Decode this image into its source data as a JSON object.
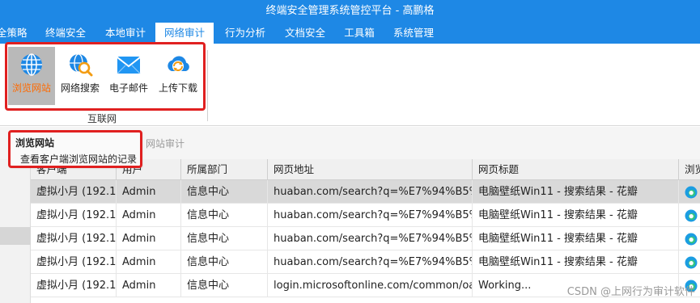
{
  "window": {
    "title": "终端安全管理系统管控平台 - 高鹏格"
  },
  "menu": {
    "items": [
      {
        "label": "全策略"
      },
      {
        "label": "终端安全"
      },
      {
        "label": "本地审计"
      },
      {
        "label": "网络审计",
        "active": true
      },
      {
        "label": "行为分析"
      },
      {
        "label": "文档安全"
      },
      {
        "label": "工具箱"
      },
      {
        "label": "系统管理"
      }
    ]
  },
  "ribbon": {
    "buttons": [
      {
        "label": "浏览网站",
        "icon": "globe-icon",
        "selected": true
      },
      {
        "label": "网络搜索",
        "icon": "globe-search-icon"
      },
      {
        "label": "电子邮件",
        "icon": "envelope-icon"
      },
      {
        "label": "上传下载",
        "icon": "cloud-sync-icon"
      }
    ],
    "group_label": "互联网"
  },
  "subbar": {
    "text": "网站审计"
  },
  "tooltip": {
    "title": "浏览网站",
    "description": "查看客户端浏览网站的记录"
  },
  "table": {
    "columns": [
      "客户端",
      "用户",
      "所属部门",
      "网页地址",
      "网页标题",
      "浏览"
    ],
    "rows": [
      {
        "client": "虚拟小月 (192.1...",
        "user": "Admin",
        "dept": "信息中心",
        "url": "huaban.com/search?q=%E7%94%B5%E...",
        "title": "电脑壁纸Win11 - 搜索结果 - 花瓣",
        "browser": "edge-icon",
        "selected": true
      },
      {
        "client": "虚拟小月 (192.1...",
        "user": "Admin",
        "dept": "信息中心",
        "url": "huaban.com/search?q=%E7%94%B5%E...",
        "title": "电脑壁纸Win11 - 搜索结果 - 花瓣",
        "browser": "edge-icon"
      },
      {
        "client": "虚拟小月 (192.1...",
        "user": "Admin",
        "dept": "信息中心",
        "url": "huaban.com/search?q=%E7%94%B5%E...",
        "title": "电脑壁纸Win11 - 搜索结果 - 花瓣",
        "browser": "edge-icon"
      },
      {
        "client": "虚拟小月 (192.1...",
        "user": "Admin",
        "dept": "信息中心",
        "url": "huaban.com/search?q=%E7%94%B5%E...",
        "title": "电脑壁纸Win11 - 搜索结果 - 花瓣",
        "browser": "edge-icon"
      },
      {
        "client": "虚拟小月 (192.1...",
        "user": "Admin",
        "dept": "信息中心",
        "url": "login.microsoftonline.com/common/oau...",
        "title": "Working...",
        "browser": "edge-icon"
      }
    ]
  },
  "watermark": "CSDN @上网行为审计软件",
  "colors": {
    "titlebar": "#1e88e5",
    "highlight_box": "#e02020",
    "selected_label": "#ff6a00"
  }
}
